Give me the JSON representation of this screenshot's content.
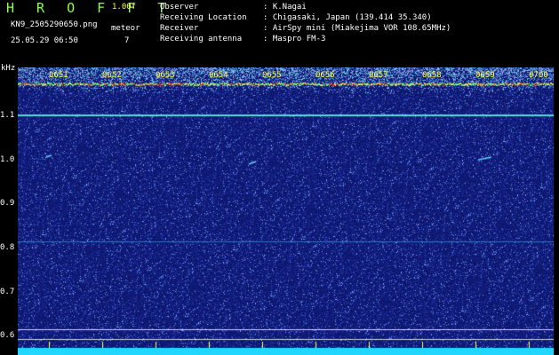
{
  "header": {
    "program": "H R O F F T",
    "version": "1.00f",
    "filename": "KN9_2505290650.png",
    "meteor_label": "meteor",
    "meteor_count": "7",
    "datetime": "25.05.29 06:50"
  },
  "info": [
    {
      "label": "Observer",
      "value": ": K.Nagai"
    },
    {
      "label": "Receiving Location",
      "value": ": Chigasaki, Japan (139.414 35.340)"
    },
    {
      "label": "Receiver",
      "value": ": AirSpy mini (Miakejima VOR 108.65MHz)"
    },
    {
      "label": "Receiving antenna",
      "value": ": Maspro FM-3"
    }
  ],
  "axis": {
    "unit": "kHz",
    "y_labels": [
      "1.1",
      "1.0",
      "0.9",
      "0.8",
      "0.7",
      "0.6"
    ]
  },
  "time_marks": [
    "0651",
    "0652",
    "0653",
    "0654",
    "0655",
    "0656",
    "0657",
    "0658",
    "0659",
    "0700"
  ],
  "colors": {
    "background": "#000000",
    "spectrogram": "#101c78",
    "title_green": "#8cff4a",
    "label_yellow": "#ffff40",
    "text_white": "#ffffff",
    "baseline_cyan": "#20e0ff"
  }
}
